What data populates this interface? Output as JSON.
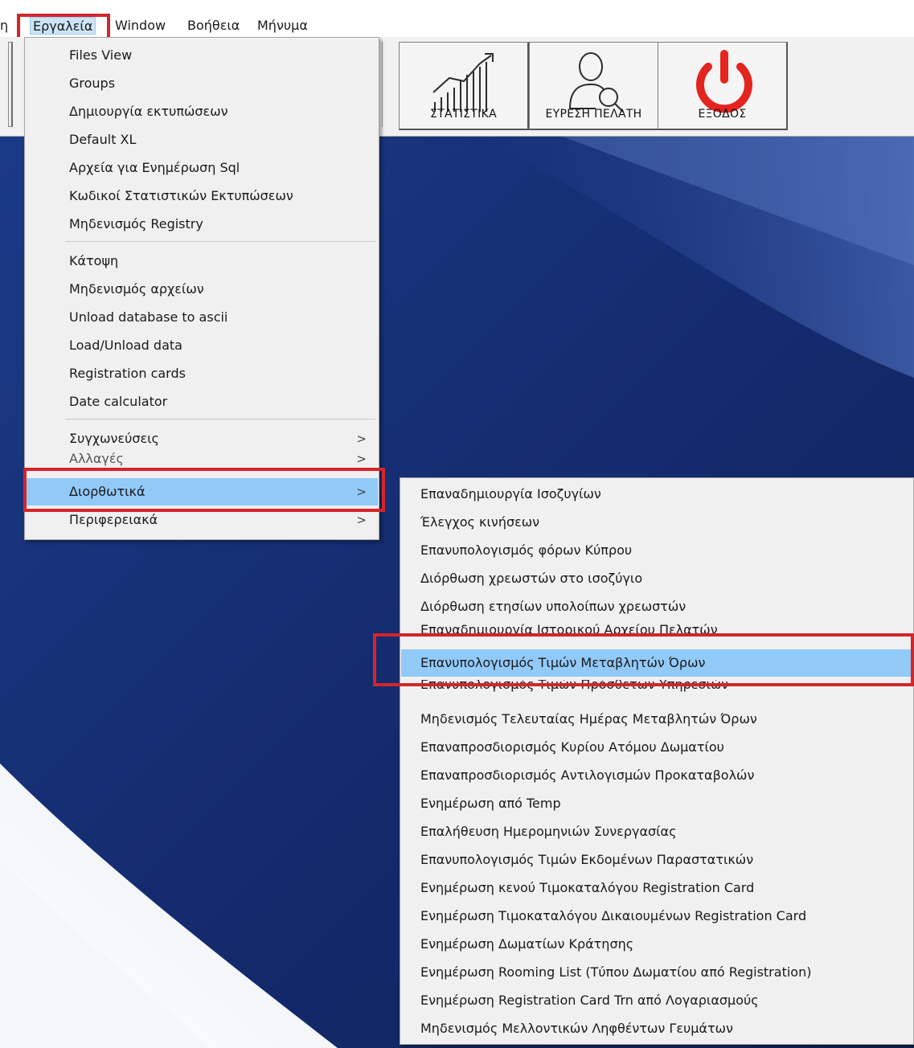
{
  "menubar": {
    "edge_label": "η",
    "items": [
      "Εργαλεία",
      "Window",
      "Βοήθεια",
      "Μήνυμα"
    ]
  },
  "toolbar": {
    "buttons": [
      {
        "label": "ΣΤΑΤΙΣΤΙΚΑ",
        "icon": "statistics-chart-icon"
      },
      {
        "label": "ΕΥΡΕΣΗ ΠΕΛΑΤΗ",
        "icon": "find-customer-icon"
      },
      {
        "label": "ΕΞΟΔΟΣ",
        "icon": "power-exit-icon"
      }
    ]
  },
  "tools_menu": {
    "items": [
      "Files View",
      "Groups",
      "Δημιουργία εκτυπώσεων",
      "Default XL",
      "Αρχεία για Ενημέρωση Sql",
      "Κωδικοί Στατιστικών Εκτυπώσεων",
      "Μηδενισμός Registry",
      "Κάτοψη",
      "Μηδενισμός αρχείων",
      "Unload database to ascii",
      "Load/Unload data",
      "Registration cards",
      "Date calculator",
      "Συγχωνεύσεις",
      "Αλλαγές",
      "Διορθωτικά",
      "Περιφερειακά"
    ],
    "submenu_arrow": ">"
  },
  "corrections_menu": {
    "items": [
      "Επαναδημιουργία Ισοζυγίων",
      "Έλεγχος κινήσεων",
      "Επανυπολογισμός φόρων Κύπρου",
      "Διόρθωση χρεωστών στο ισοζύγιο",
      "Διόρθωση ετησίων υπολοίπων χρεωστών",
      "Επαναδημιουργία Ιστορικού Αρχείου Πελατών",
      "Επανυπολογισμός Τιμών Μεταβλητών Όρων",
      "Επανυπολογισμός Τιμών Πρόσθετων Υπηρεσιών",
      "Μηδενισμός Τελευταίας Ημέρας Μεταβλητών Όρων",
      "Επαναπροσδιορισμός Κυρίου Ατόμου Δωματίου",
      "Επαναπροσδιορισμός Αντιλογισμών Προκαταβολών",
      "Ενημέρωση από Temp",
      "Επαλήθευση Ημερομηνιών Συνεργασίας",
      "Επανυπολογισμός Τιμών Εκδομένων Παραστατικών",
      "Ενημέρωση κενού Τιμοκαταλόγου Registration Card",
      "Ενημέρωση Τιμοκαταλόγου Δικαιουμένων Registration Card",
      "Ενημέρωση Δωματίων Κράτησης",
      "Ενημέρωση Rooming List (Τύπου Δωματίου από Registration)",
      "Ενημέρωση Registration Card Trn από Λογαριασμούς",
      "Μηδενισμός Μελλοντικών Ληφθέντων Γευμάτων"
    ]
  },
  "colors": {
    "highlight": "#91c9f7",
    "annotation_red": "#d4252b",
    "background_blue": "#142a66",
    "exit_red": "#e3241f"
  }
}
